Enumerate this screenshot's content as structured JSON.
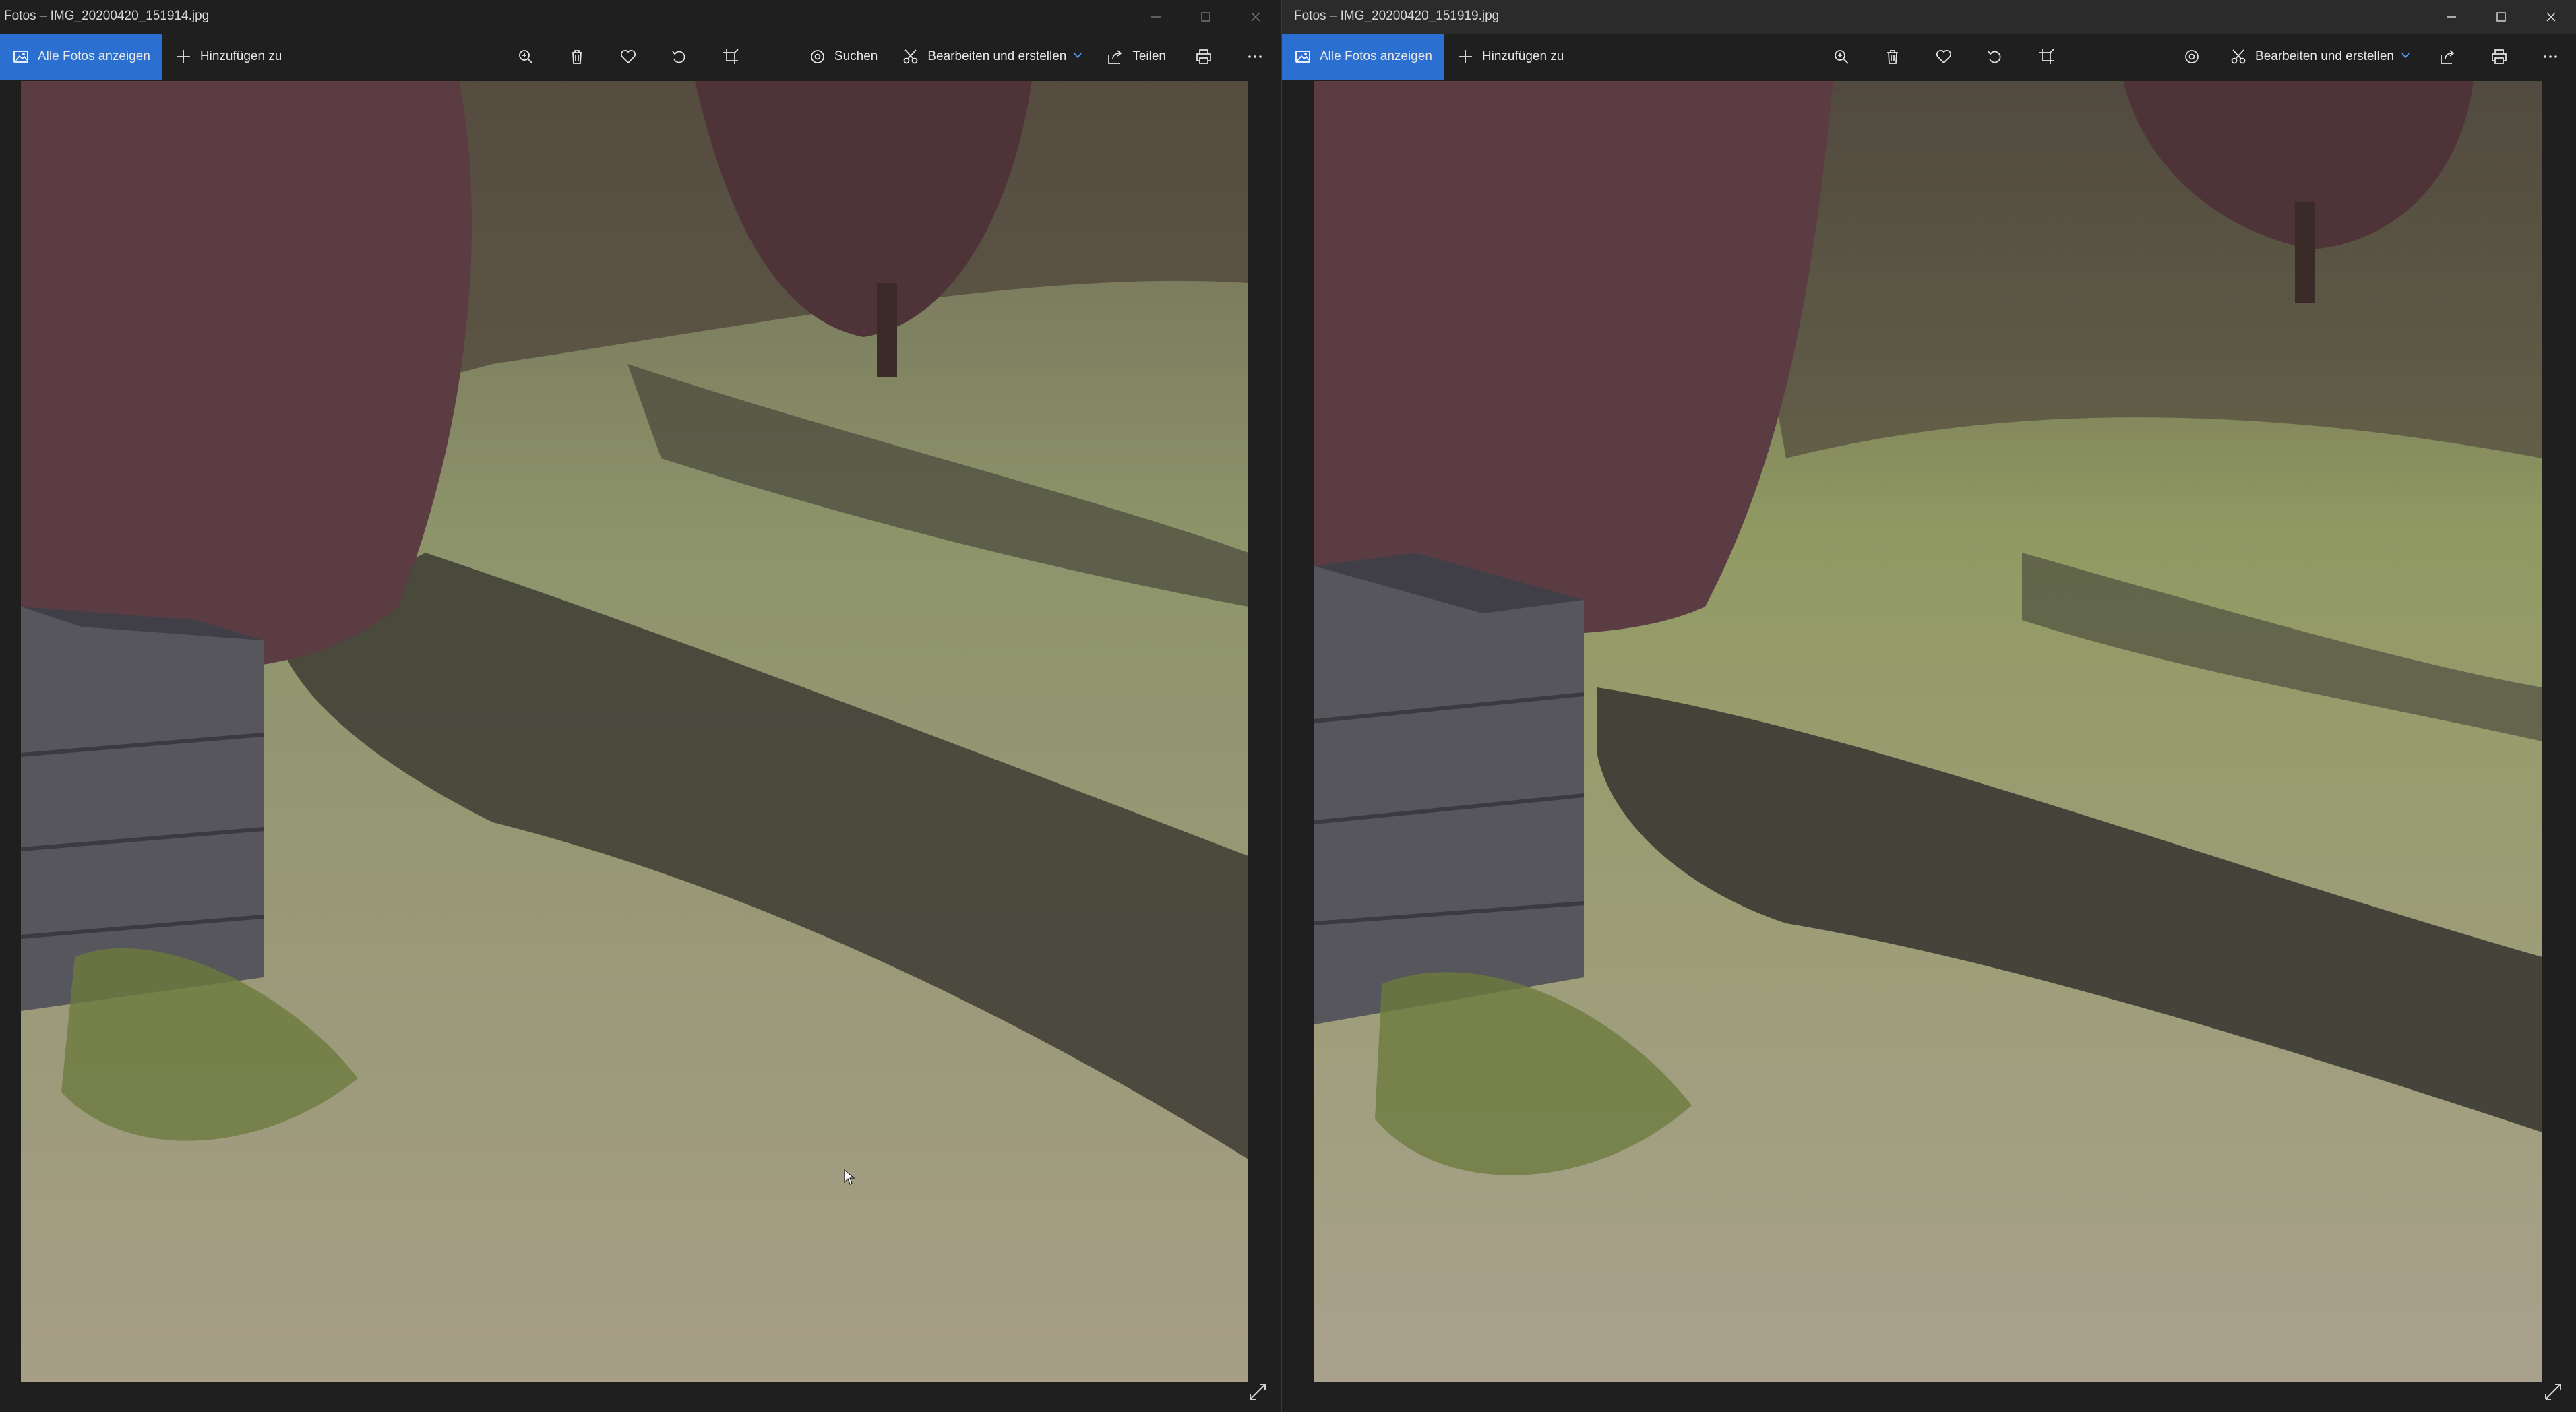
{
  "windows": [
    {
      "title": "Fotos – IMG_20200420_151914.jpg",
      "toolbar": {
        "all_photos": "Alle Fotos anzeigen",
        "add_to": "Hinzufügen zu",
        "search": "Suchen",
        "edit_create": "Bearbeiten und erstellen",
        "share": "Teilen"
      }
    },
    {
      "title": "Fotos – IMG_20200420_151919.jpg",
      "toolbar": {
        "all_photos": "Alle Fotos anzeigen",
        "add_to": "Hinzufügen zu",
        "edit_create": "Bearbeiten und erstellen"
      }
    }
  ],
  "colors": {
    "accent": "#2b6fd0",
    "chrome": "#1f1f1f",
    "grass": "#8f9a5a",
    "shadow": "#3b3a33",
    "hedge": "#5b3c43",
    "crate": "#5a5a60"
  }
}
